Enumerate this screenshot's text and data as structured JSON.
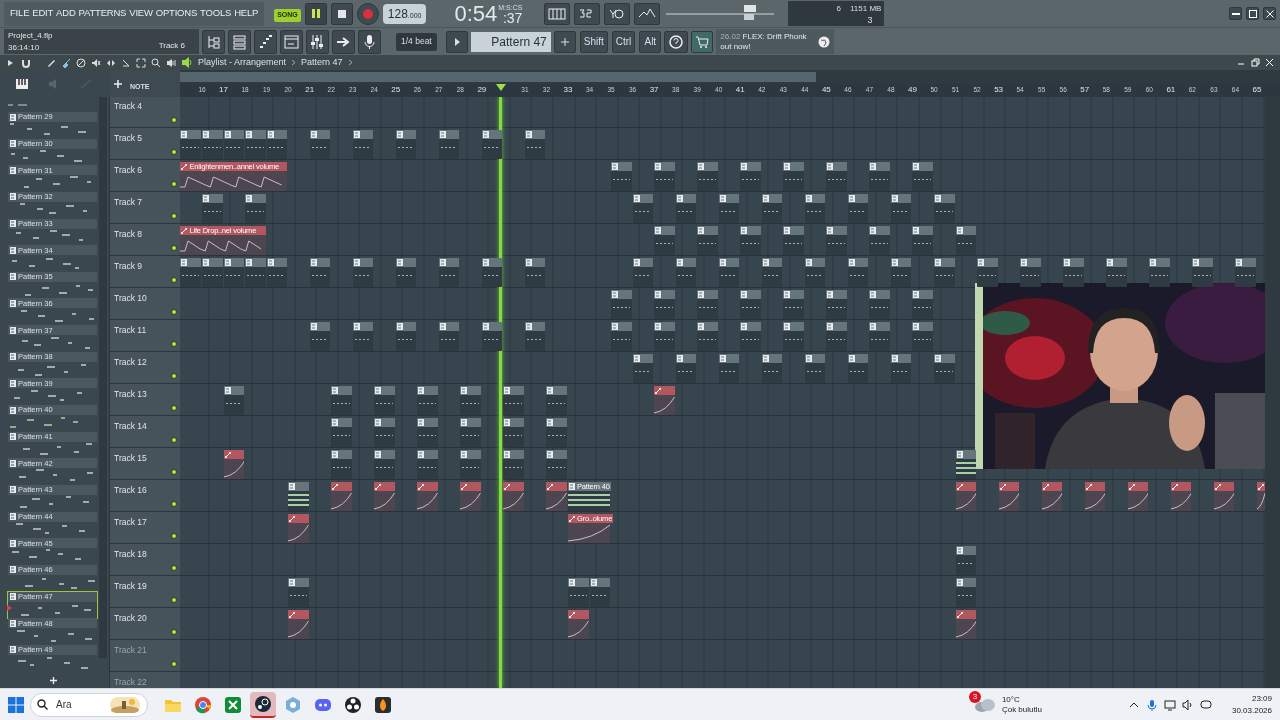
{
  "menu": [
    "FILE",
    "EDIT",
    "ADD",
    "PATTERNS",
    "VIEW",
    "OPTIONS",
    "TOOLS",
    "HELP"
  ],
  "transport": {
    "mode": "SONG",
    "playing": true,
    "tempo": "128",
    "tempo_fraction": ".000",
    "time": "0:54",
    "time_fraction": ":37",
    "time_format": "M:S:CS"
  },
  "monitor": {
    "cpu": "6",
    "memory": "1151 MB",
    "polyphony": "3"
  },
  "hint": {
    "file": "Project_4.flp",
    "time": "36:14:10",
    "track": "Track 6"
  },
  "toolbar": {
    "snap": "1/4 beat",
    "pattern": "Pattern 47",
    "modifiers": [
      "Shift",
      "Ctrl",
      "Alt"
    ]
  },
  "news": {
    "date": "26.02",
    "text": "FLEX: Drift Phonk out now!"
  },
  "playlist": {
    "title": "Playlist - Arrangement",
    "pattern": "Pattern 47",
    "mode_label": "NOTE",
    "ruler_before_playhead": [
      "16",
      "17",
      "18",
      "19",
      "20",
      "21",
      "22",
      "23",
      "24",
      "25",
      "26",
      "27",
      "28",
      "29"
    ],
    "ruler_after_playhead": [
      "31",
      "32",
      "33",
      "34",
      "35",
      "36",
      "37",
      "38",
      "39",
      "40",
      "41",
      "42",
      "43",
      "44",
      "45",
      "46",
      "47",
      "48",
      "49",
      "50",
      "51",
      "52",
      "53",
      "54",
      "55",
      "56",
      "57",
      "58",
      "59",
      "60",
      "61",
      "62",
      "63",
      "64",
      "65"
    ],
    "playhead": {
      "level": 0.295
    },
    "patterns": [
      {
        "label": "Pattern 29",
        "selected": false
      },
      {
        "label": "Pattern 30",
        "selected": false
      },
      {
        "label": "Pattern 31",
        "selected": false
      },
      {
        "label": "Pattern 32",
        "selected": false
      },
      {
        "label": "Pattern 33",
        "selected": false
      },
      {
        "label": "Pattern 34",
        "selected": false
      },
      {
        "label": "Pattern 35",
        "selected": false
      },
      {
        "label": "Pattern 36",
        "selected": false
      },
      {
        "label": "Pattern 37",
        "selected": false
      },
      {
        "label": "Pattern 38",
        "selected": false
      },
      {
        "label": "Pattern 39",
        "selected": false
      },
      {
        "label": "Pattern 40",
        "selected": false
      },
      {
        "label": "Pattern 41",
        "selected": false
      },
      {
        "label": "Pattern 42",
        "selected": false
      },
      {
        "label": "Pattern 43",
        "selected": false
      },
      {
        "label": "Pattern 44",
        "selected": false
      },
      {
        "label": "Pattern 45",
        "selected": false
      },
      {
        "label": "Pattern 46",
        "selected": false
      },
      {
        "label": "Pattern 47",
        "selected": true
      },
      {
        "label": "Pattern 48",
        "selected": false
      },
      {
        "label": "Pattern 49",
        "selected": false
      }
    ],
    "tracks": [
      {
        "name": "Track 4",
        "enabled": true
      },
      {
        "name": "Track 5",
        "enabled": true,
        "lane": [
          {
            "kind": "pattern"
          },
          {
            "kind": "pattern"
          },
          {
            "kind": "pattern"
          },
          {
            "kind": "pattern"
          },
          {
            "kind": "pattern"
          },
          {
            "kind": "gap"
          },
          {
            "kind": "pattern"
          },
          {
            "kind": "gap"
          },
          {
            "kind": "pattern"
          },
          {
            "kind": "gap"
          },
          {
            "kind": "pattern"
          },
          {
            "kind": "gap"
          },
          {
            "kind": "pattern"
          },
          {
            "kind": "gap"
          },
          {
            "kind": "pattern"
          },
          {
            "kind": "gap"
          },
          {
            "kind": "pattern"
          }
        ]
      },
      {
        "name": "Track 6",
        "enabled": true,
        "lane": [
          {
            "kind": "automation",
            "label": "Enlightenmen..annel volume"
          },
          {
            "kind": "continued"
          },
          {
            "kind": "continued"
          },
          {
            "kind": "continued"
          },
          {
            "kind": "continued"
          },
          {
            "kind": "gap"
          },
          {
            "kind": "gap"
          },
          {
            "kind": "gap"
          },
          {
            "kind": "gap"
          },
          {
            "kind": "gap"
          },
          {
            "kind": "gap"
          },
          {
            "kind": "gap"
          },
          {
            "kind": "gap"
          },
          {
            "kind": "gap"
          },
          {
            "kind": "gap"
          },
          {
            "kind": "gap"
          },
          {
            "kind": "gap"
          },
          {
            "kind": "gap"
          },
          {
            "kind": "gap"
          },
          {
            "kind": "gap"
          },
          {
            "kind": "pattern"
          },
          {
            "kind": "gap"
          },
          {
            "kind": "pattern"
          },
          {
            "kind": "gap"
          },
          {
            "kind": "pattern"
          },
          {
            "kind": "gap"
          },
          {
            "kind": "pattern"
          },
          {
            "kind": "gap"
          },
          {
            "kind": "pattern"
          },
          {
            "kind": "gap"
          },
          {
            "kind": "pattern"
          },
          {
            "kind": "gap"
          },
          {
            "kind": "pattern"
          },
          {
            "kind": "gap"
          },
          {
            "kind": "pattern"
          }
        ]
      },
      {
        "name": "Track 7",
        "enabled": true,
        "lane": [
          {
            "kind": "gap"
          },
          {
            "kind": "pattern"
          },
          {
            "kind": "gap"
          },
          {
            "kind": "pattern"
          },
          {
            "kind": "gap"
          },
          {
            "kind": "gap"
          },
          {
            "kind": "gap"
          },
          {
            "kind": "gap"
          },
          {
            "kind": "gap"
          },
          {
            "kind": "gap"
          },
          {
            "kind": "gap"
          },
          {
            "kind": "gap"
          },
          {
            "kind": "gap"
          },
          {
            "kind": "gap"
          },
          {
            "kind": "gap"
          },
          {
            "kind": "gap"
          },
          {
            "kind": "gap"
          },
          {
            "kind": "gap"
          },
          {
            "kind": "gap"
          },
          {
            "kind": "gap"
          },
          {
            "kind": "gap"
          },
          {
            "kind": "pattern"
          },
          {
            "kind": "gap"
          },
          {
            "kind": "pattern"
          },
          {
            "kind": "gap"
          },
          {
            "kind": "pattern"
          },
          {
            "kind": "gap"
          },
          {
            "kind": "pattern"
          },
          {
            "kind": "gap"
          },
          {
            "kind": "pattern"
          },
          {
            "kind": "gap"
          },
          {
            "kind": "pattern"
          },
          {
            "kind": "gap"
          },
          {
            "kind": "pattern"
          },
          {
            "kind": "gap"
          },
          {
            "kind": "pattern"
          }
        ]
      },
      {
        "name": "Track 8",
        "enabled": true,
        "lane": [
          {
            "kind": "automation",
            "label": "Life Drop..nel volume"
          },
          {
            "kind": "continued"
          },
          {
            "kind": "continued"
          },
          {
            "kind": "continued"
          },
          {
            "kind": "gap"
          },
          {
            "kind": "gap"
          },
          {
            "kind": "gap"
          },
          {
            "kind": "gap"
          },
          {
            "kind": "gap"
          },
          {
            "kind": "gap"
          },
          {
            "kind": "gap"
          },
          {
            "kind": "gap"
          },
          {
            "kind": "gap"
          },
          {
            "kind": "gap"
          },
          {
            "kind": "gap"
          },
          {
            "kind": "gap"
          },
          {
            "kind": "gap"
          },
          {
            "kind": "gap"
          },
          {
            "kind": "gap"
          },
          {
            "kind": "gap"
          },
          {
            "kind": "gap"
          },
          {
            "kind": "gap"
          },
          {
            "kind": "pattern"
          },
          {
            "kind": "gap"
          },
          {
            "kind": "pattern"
          },
          {
            "kind": "gap"
          },
          {
            "kind": "pattern"
          },
          {
            "kind": "gap"
          },
          {
            "kind": "pattern"
          },
          {
            "kind": "gap"
          },
          {
            "kind": "pattern"
          },
          {
            "kind": "gap"
          },
          {
            "kind": "pattern"
          },
          {
            "kind": "gap"
          },
          {
            "kind": "pattern"
          },
          {
            "kind": "gap"
          },
          {
            "kind": "pattern"
          }
        ]
      },
      {
        "name": "Track 9",
        "enabled": true,
        "lane": [
          {
            "kind": "pattern"
          },
          {
            "kind": "pattern"
          },
          {
            "kind": "pattern"
          },
          {
            "kind": "pattern"
          },
          {
            "kind": "pattern"
          },
          {
            "kind": "gap"
          },
          {
            "kind": "pattern"
          },
          {
            "kind": "gap"
          },
          {
            "kind": "pattern"
          },
          {
            "kind": "gap"
          },
          {
            "kind": "pattern"
          },
          {
            "kind": "gap"
          },
          {
            "kind": "pattern"
          },
          {
            "kind": "gap"
          },
          {
            "kind": "pattern"
          },
          {
            "kind": "gap"
          },
          {
            "kind": "pattern"
          },
          {
            "kind": "gap"
          },
          {
            "kind": "gap"
          },
          {
            "kind": "gap"
          },
          {
            "kind": "gap"
          },
          {
            "kind": "pattern"
          },
          {
            "kind": "gap"
          },
          {
            "kind": "pattern"
          },
          {
            "kind": "gap"
          },
          {
            "kind": "pattern"
          },
          {
            "kind": "gap"
          },
          {
            "kind": "pattern"
          },
          {
            "kind": "gap"
          },
          {
            "kind": "pattern"
          },
          {
            "kind": "gap"
          },
          {
            "kind": "pattern"
          },
          {
            "kind": "gap"
          },
          {
            "kind": "pattern"
          },
          {
            "kind": "gap"
          },
          {
            "kind": "pattern"
          },
          {
            "kind": "gap"
          },
          {
            "kind": "pattern"
          },
          {
            "kind": "gap"
          },
          {
            "kind": "pattern"
          },
          {
            "kind": "gap"
          },
          {
            "kind": "pattern"
          },
          {
            "kind": "gap"
          },
          {
            "kind": "pattern"
          },
          {
            "kind": "gap"
          },
          {
            "kind": "pattern"
          },
          {
            "kind": "gap"
          },
          {
            "kind": "pattern"
          },
          {
            "kind": "gap"
          },
          {
            "kind": "pattern"
          }
        ]
      },
      {
        "name": "Track 10",
        "enabled": true,
        "lane": [
          {
            "kind": "gap"
          },
          {
            "kind": "gap"
          },
          {
            "kind": "gap"
          },
          {
            "kind": "gap"
          },
          {
            "kind": "gap"
          },
          {
            "kind": "gap"
          },
          {
            "kind": "gap"
          },
          {
            "kind": "gap"
          },
          {
            "kind": "gap"
          },
          {
            "kind": "gap"
          },
          {
            "kind": "gap"
          },
          {
            "kind": "gap"
          },
          {
            "kind": "gap"
          },
          {
            "kind": "gap"
          },
          {
            "kind": "gap"
          },
          {
            "kind": "gap"
          },
          {
            "kind": "gap"
          },
          {
            "kind": "gap"
          },
          {
            "kind": "gap"
          },
          {
            "kind": "gap"
          },
          {
            "kind": "pattern"
          },
          {
            "kind": "gap"
          },
          {
            "kind": "pattern"
          },
          {
            "kind": "gap"
          },
          {
            "kind": "pattern"
          },
          {
            "kind": "gap"
          },
          {
            "kind": "pattern"
          },
          {
            "kind": "gap"
          },
          {
            "kind": "pattern"
          },
          {
            "kind": "gap"
          },
          {
            "kind": "pattern"
          },
          {
            "kind": "gap"
          },
          {
            "kind": "pattern"
          },
          {
            "kind": "gap"
          },
          {
            "kind": "pattern"
          }
        ]
      },
      {
        "name": "Track 11",
        "enabled": true,
        "lane": [
          {
            "kind": "gap"
          },
          {
            "kind": "gap"
          },
          {
            "kind": "gap"
          },
          {
            "kind": "gap"
          },
          {
            "kind": "gap"
          },
          {
            "kind": "gap"
          },
          {
            "kind": "pattern"
          },
          {
            "kind": "gap"
          },
          {
            "kind": "pattern"
          },
          {
            "kind": "gap"
          },
          {
            "kind": "pattern"
          },
          {
            "kind": "gap"
          },
          {
            "kind": "pattern"
          },
          {
            "kind": "gap"
          },
          {
            "kind": "pattern"
          },
          {
            "kind": "gap"
          },
          {
            "kind": "pattern"
          },
          {
            "kind": "gap"
          },
          {
            "kind": "gap"
          },
          {
            "kind": "gap"
          },
          {
            "kind": "pattern"
          },
          {
            "kind": "gap"
          },
          {
            "kind": "pattern"
          },
          {
            "kind": "gap"
          },
          {
            "kind": "pattern"
          },
          {
            "kind": "gap"
          },
          {
            "kind": "pattern"
          },
          {
            "kind": "gap"
          },
          {
            "kind": "pattern"
          },
          {
            "kind": "gap"
          },
          {
            "kind": "pattern"
          },
          {
            "kind": "gap"
          },
          {
            "kind": "pattern"
          },
          {
            "kind": "gap"
          },
          {
            "kind": "pattern"
          }
        ]
      },
      {
        "name": "Track 12",
        "enabled": true,
        "lane": [
          {
            "kind": "gap"
          },
          {
            "kind": "gap"
          },
          {
            "kind": "gap"
          },
          {
            "kind": "gap"
          },
          {
            "kind": "gap"
          },
          {
            "kind": "gap"
          },
          {
            "kind": "gap"
          },
          {
            "kind": "gap"
          },
          {
            "kind": "gap"
          },
          {
            "kind": "gap"
          },
          {
            "kind": "gap"
          },
          {
            "kind": "gap"
          },
          {
            "kind": "gap"
          },
          {
            "kind": "gap"
          },
          {
            "kind": "gap"
          },
          {
            "kind": "gap"
          },
          {
            "kind": "gap"
          },
          {
            "kind": "gap"
          },
          {
            "kind": "gap"
          },
          {
            "kind": "gap"
          },
          {
            "kind": "gap"
          },
          {
            "kind": "pattern"
          },
          {
            "kind": "gap"
          },
          {
            "kind": "pattern"
          },
          {
            "kind": "gap"
          },
          {
            "kind": "pattern"
          },
          {
            "kind": "gap"
          },
          {
            "kind": "pattern"
          },
          {
            "kind": "gap"
          },
          {
            "kind": "pattern"
          },
          {
            "kind": "gap"
          },
          {
            "kind": "pattern"
          },
          {
            "kind": "gap"
          },
          {
            "kind": "pattern"
          },
          {
            "kind": "gap"
          },
          {
            "kind": "pattern"
          }
        ]
      },
      {
        "name": "Track 13",
        "enabled": true,
        "lane": [
          {
            "kind": "gap"
          },
          {
            "kind": "gap"
          },
          {
            "kind": "pattern"
          },
          {
            "kind": "gap"
          },
          {
            "kind": "gap"
          },
          {
            "kind": "gap"
          },
          {
            "kind": "gap"
          },
          {
            "kind": "pattern"
          },
          {
            "kind": "gap"
          },
          {
            "kind": "pattern"
          },
          {
            "kind": "gap"
          },
          {
            "kind": "pattern"
          },
          {
            "kind": "gap"
          },
          {
            "kind": "pattern"
          },
          {
            "kind": "gap"
          },
          {
            "kind": "pattern"
          },
          {
            "kind": "gap"
          },
          {
            "kind": "pattern"
          },
          {
            "kind": "gap"
          },
          {
            "kind": "gap"
          },
          {
            "kind": "gap"
          },
          {
            "kind": "gap"
          },
          {
            "kind": "automation"
          }
        ]
      },
      {
        "name": "Track 14",
        "enabled": true,
        "lane": [
          {
            "kind": "gap"
          },
          {
            "kind": "gap"
          },
          {
            "kind": "gap"
          },
          {
            "kind": "gap"
          },
          {
            "kind": "gap"
          },
          {
            "kind": "gap"
          },
          {
            "kind": "gap"
          },
          {
            "kind": "pattern"
          },
          {
            "kind": "gap"
          },
          {
            "kind": "pattern"
          },
          {
            "kind": "gap"
          },
          {
            "kind": "pattern"
          },
          {
            "kind": "gap"
          },
          {
            "kind": "pattern"
          },
          {
            "kind": "gap"
          },
          {
            "kind": "pattern"
          },
          {
            "kind": "gap"
          },
          {
            "kind": "pattern"
          }
        ]
      },
      {
        "name": "Track 15",
        "enabled": true,
        "lane": [
          {
            "kind": "gap"
          },
          {
            "kind": "gap"
          },
          {
            "kind": "automation"
          },
          {
            "kind": "gap"
          },
          {
            "kind": "gap"
          },
          {
            "kind": "gap"
          },
          {
            "kind": "gap"
          },
          {
            "kind": "pattern"
          },
          {
            "kind": "gap"
          },
          {
            "kind": "pattern"
          },
          {
            "kind": "gap"
          },
          {
            "kind": "pattern"
          },
          {
            "kind": "gap"
          },
          {
            "kind": "pattern"
          },
          {
            "kind": "gap"
          },
          {
            "kind": "pattern"
          },
          {
            "kind": "gap"
          },
          {
            "kind": "pattern"
          },
          {
            "kind": "gap"
          },
          {
            "kind": "gap"
          },
          {
            "kind": "gap"
          },
          {
            "kind": "gap"
          },
          {
            "kind": "gap"
          },
          {
            "kind": "gap"
          },
          {
            "kind": "gap"
          },
          {
            "kind": "gap"
          },
          {
            "kind": "gap"
          },
          {
            "kind": "gap"
          },
          {
            "kind": "gap"
          },
          {
            "kind": "gap"
          },
          {
            "kind": "gap"
          },
          {
            "kind": "gap"
          },
          {
            "kind": "gap"
          },
          {
            "kind": "gap"
          },
          {
            "kind": "gap"
          },
          {
            "kind": "gap"
          },
          {
            "kind": "pattern_lines"
          }
        ]
      },
      {
        "name": "Track 16",
        "enabled": true,
        "lane": [
          {
            "kind": "gap"
          },
          {
            "kind": "gap"
          },
          {
            "kind": "gap"
          },
          {
            "kind": "gap"
          },
          {
            "kind": "gap"
          },
          {
            "kind": "pattern_lines"
          },
          {
            "kind": "gap"
          },
          {
            "kind": "automation"
          },
          {
            "kind": "gap"
          },
          {
            "kind": "automation"
          },
          {
            "kind": "gap"
          },
          {
            "kind": "automation"
          },
          {
            "kind": "gap"
          },
          {
            "kind": "automation"
          },
          {
            "kind": "gap"
          },
          {
            "kind": "automation"
          },
          {
            "kind": "gap"
          },
          {
            "kind": "automation"
          },
          {
            "kind": "pattern_lines",
            "label": "Pattern 40"
          },
          {
            "kind": "continued"
          },
          {
            "kind": "gap"
          },
          {
            "kind": "gap"
          },
          {
            "kind": "gap"
          },
          {
            "kind": "gap"
          },
          {
            "kind": "gap"
          },
          {
            "kind": "gap"
          },
          {
            "kind": "gap"
          },
          {
            "kind": "gap"
          },
          {
            "kind": "gap"
          },
          {
            "kind": "gap"
          },
          {
            "kind": "gap"
          },
          {
            "kind": "gap"
          },
          {
            "kind": "gap"
          },
          {
            "kind": "gap"
          },
          {
            "kind": "gap"
          },
          {
            "kind": "gap"
          },
          {
            "kind": "automation"
          },
          {
            "kind": "gap"
          },
          {
            "kind": "automation"
          },
          {
            "kind": "gap"
          },
          {
            "kind": "automation"
          },
          {
            "kind": "gap"
          },
          {
            "kind": "automation"
          },
          {
            "kind": "gap"
          },
          {
            "kind": "automation"
          },
          {
            "kind": "gap"
          },
          {
            "kind": "automation"
          },
          {
            "kind": "gap"
          },
          {
            "kind": "automation"
          },
          {
            "kind": "gap"
          },
          {
            "kind": "automation"
          }
        ]
      },
      {
        "name": "Track 17",
        "enabled": true,
        "lane": [
          {
            "kind": "gap"
          },
          {
            "kind": "gap"
          },
          {
            "kind": "gap"
          },
          {
            "kind": "gap"
          },
          {
            "kind": "gap"
          },
          {
            "kind": "automation"
          },
          {
            "kind": "gap"
          },
          {
            "kind": "gap"
          },
          {
            "kind": "gap"
          },
          {
            "kind": "gap"
          },
          {
            "kind": "gap"
          },
          {
            "kind": "gap"
          },
          {
            "kind": "gap"
          },
          {
            "kind": "gap"
          },
          {
            "kind": "gap"
          },
          {
            "kind": "gap"
          },
          {
            "kind": "gap"
          },
          {
            "kind": "gap"
          },
          {
            "kind": "automation",
            "label": "Gro..olume"
          },
          {
            "kind": "continued"
          }
        ]
      },
      {
        "name": "Track 18",
        "enabled": true,
        "lane": [
          {
            "kind": "gap"
          },
          {
            "kind": "gap"
          },
          {
            "kind": "gap"
          },
          {
            "kind": "gap"
          },
          {
            "kind": "gap"
          },
          {
            "kind": "gap"
          },
          {
            "kind": "gap"
          },
          {
            "kind": "gap"
          },
          {
            "kind": "gap"
          },
          {
            "kind": "gap"
          },
          {
            "kind": "gap"
          },
          {
            "kind": "gap"
          },
          {
            "kind": "gap"
          },
          {
            "kind": "gap"
          },
          {
            "kind": "gap"
          },
          {
            "kind": "gap"
          },
          {
            "kind": "gap"
          },
          {
            "kind": "gap"
          },
          {
            "kind": "gap"
          },
          {
            "kind": "gap"
          },
          {
            "kind": "gap"
          },
          {
            "kind": "gap"
          },
          {
            "kind": "gap"
          },
          {
            "kind": "gap"
          },
          {
            "kind": "gap"
          },
          {
            "kind": "gap"
          },
          {
            "kind": "gap"
          },
          {
            "kind": "gap"
          },
          {
            "kind": "gap"
          },
          {
            "kind": "gap"
          },
          {
            "kind": "gap"
          },
          {
            "kind": "gap"
          },
          {
            "kind": "gap"
          },
          {
            "kind": "gap"
          },
          {
            "kind": "gap"
          },
          {
            "kind": "gap"
          },
          {
            "kind": "pattern"
          }
        ]
      },
      {
        "name": "Track 19",
        "enabled": true,
        "lane": [
          {
            "kind": "gap"
          },
          {
            "kind": "gap"
          },
          {
            "kind": "gap"
          },
          {
            "kind": "gap"
          },
          {
            "kind": "gap"
          },
          {
            "kind": "pattern"
          },
          {
            "kind": "gap"
          },
          {
            "kind": "gap"
          },
          {
            "kind": "gap"
          },
          {
            "kind": "gap"
          },
          {
            "kind": "gap"
          },
          {
            "kind": "gap"
          },
          {
            "kind": "gap"
          },
          {
            "kind": "gap"
          },
          {
            "kind": "gap"
          },
          {
            "kind": "gap"
          },
          {
            "kind": "gap"
          },
          {
            "kind": "gap"
          },
          {
            "kind": "pattern"
          },
          {
            "kind": "pattern"
          },
          {
            "kind": "gap"
          },
          {
            "kind": "gap"
          },
          {
            "kind": "gap"
          },
          {
            "kind": "gap"
          },
          {
            "kind": "gap"
          },
          {
            "kind": "gap"
          },
          {
            "kind": "gap"
          },
          {
            "kind": "gap"
          },
          {
            "kind": "gap"
          },
          {
            "kind": "gap"
          },
          {
            "kind": "gap"
          },
          {
            "kind": "gap"
          },
          {
            "kind": "gap"
          },
          {
            "kind": "gap"
          },
          {
            "kind": "gap"
          },
          {
            "kind": "gap"
          },
          {
            "kind": "pattern"
          }
        ]
      },
      {
        "name": "Track 20",
        "enabled": true,
        "lane": [
          {
            "kind": "gap"
          },
          {
            "kind": "gap"
          },
          {
            "kind": "gap"
          },
          {
            "kind": "gap"
          },
          {
            "kind": "gap"
          },
          {
            "kind": "automation"
          },
          {
            "kind": "gap"
          },
          {
            "kind": "gap"
          },
          {
            "kind": "gap"
          },
          {
            "kind": "gap"
          },
          {
            "kind": "gap"
          },
          {
            "kind": "gap"
          },
          {
            "kind": "gap"
          },
          {
            "kind": "gap"
          },
          {
            "kind": "gap"
          },
          {
            "kind": "gap"
          },
          {
            "kind": "gap"
          },
          {
            "kind": "gap"
          },
          {
            "kind": "automation"
          },
          {
            "kind": "gap"
          },
          {
            "kind": "gap"
          },
          {
            "kind": "gap"
          },
          {
            "kind": "gap"
          },
          {
            "kind": "gap"
          },
          {
            "kind": "gap"
          },
          {
            "kind": "gap"
          },
          {
            "kind": "gap"
          },
          {
            "kind": "gap"
          },
          {
            "kind": "gap"
          },
          {
            "kind": "gap"
          },
          {
            "kind": "gap"
          },
          {
            "kind": "gap"
          },
          {
            "kind": "gap"
          },
          {
            "kind": "gap"
          },
          {
            "kind": "gap"
          },
          {
            "kind": "gap"
          },
          {
            "kind": "automation"
          }
        ]
      },
      {
        "name": "Track 21",
        "enabled": false
      },
      {
        "name": "Track 22",
        "enabled": false
      }
    ]
  },
  "taskbar": {
    "search": {
      "placeholder": "Ara"
    },
    "apps": [
      {
        "kind": "folder",
        "selected": false
      },
      {
        "kind": "browser",
        "selected": false
      },
      {
        "kind": "xbox",
        "selected": false
      },
      {
        "kind": "steam",
        "selected": true
      },
      {
        "kind": "network",
        "selected": false
      },
      {
        "kind": "chat",
        "selected": false
      },
      {
        "kind": "obs",
        "selected": false
      },
      {
        "kind": "fl",
        "selected": false
      }
    ],
    "weather": {
      "badge": "3",
      "temperature": "10°C",
      "condition": "Çok bulutlu"
    },
    "clock": {
      "time": "23:09",
      "date": "30.03.2026"
    }
  }
}
